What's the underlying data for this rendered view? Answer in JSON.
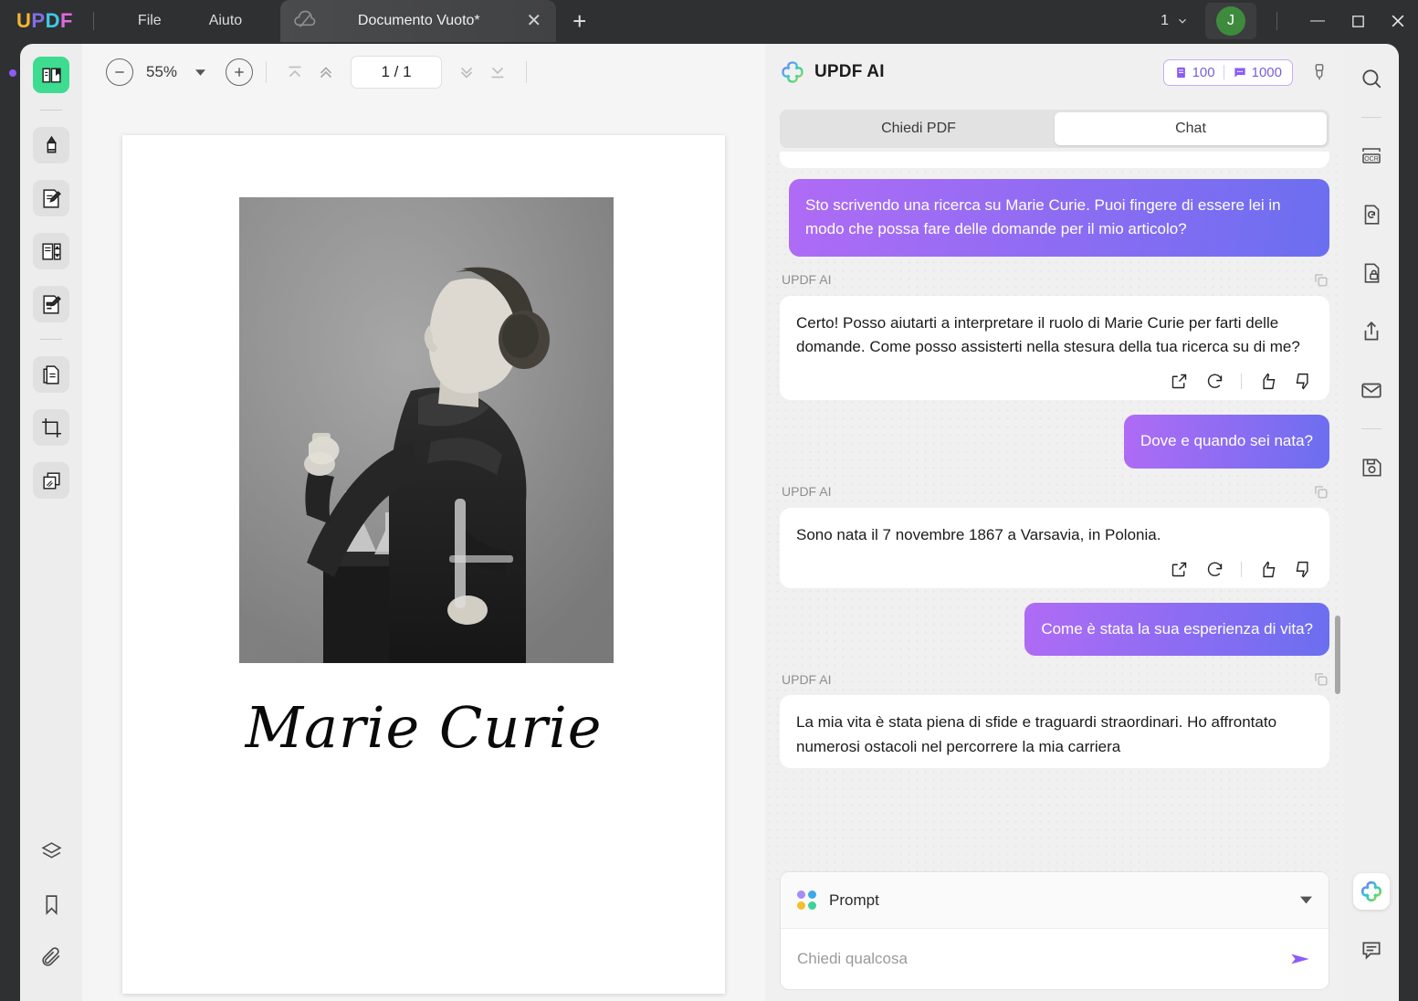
{
  "titlebar": {
    "brand": [
      "U",
      "P",
      "D",
      "F"
    ],
    "menus": [
      {
        "label": "File",
        "name": "menu-file"
      },
      {
        "label": "Aiuto",
        "name": "menu-aiuto"
      }
    ],
    "tab": {
      "title": "Documento Vuoto*",
      "close": "✕",
      "add": "+"
    },
    "page_indicator": "1",
    "avatar_initial": "J",
    "window": {
      "minimize": "—",
      "maximize": "□",
      "close": "✕"
    }
  },
  "toolbar": {
    "zoom_out": "−",
    "zoom_value": "55%",
    "zoom_in": "+",
    "page_field": "1 / 1"
  },
  "document": {
    "signature": "Marie Curie",
    "photo_alt": "marie-curie-portrait"
  },
  "left_rail": {
    "items": [
      {
        "name": "reader-icon",
        "label": "Lettore"
      },
      {
        "name": "annotate-highlighter-icon",
        "label": "Commento"
      },
      {
        "name": "edit-pdf-icon",
        "label": "Modifica PDF"
      },
      {
        "name": "organize-pages-icon",
        "label": "Organizza pagine"
      },
      {
        "name": "form-edit-icon",
        "label": "Modulo"
      },
      {
        "name": "page-convert-icon",
        "label": "Converti"
      },
      {
        "name": "crop-icon",
        "label": "Ritaglia"
      },
      {
        "name": "batch-icon",
        "label": "Batch"
      }
    ],
    "bottom_items": [
      {
        "name": "layers-icon",
        "label": "Livelli"
      },
      {
        "name": "bookmark-icon",
        "label": "Segnalibro"
      },
      {
        "name": "attachment-icon",
        "label": "Allegato"
      }
    ]
  },
  "right_rail": {
    "items": [
      {
        "name": "search-icon",
        "label": "Cerca"
      },
      {
        "name": "ocr-icon",
        "label": "OCR"
      },
      {
        "name": "convert-icon",
        "label": "Converti"
      },
      {
        "name": "protect-icon",
        "label": "Proteggi"
      },
      {
        "name": "share-icon",
        "label": "Condividi"
      },
      {
        "name": "email-icon",
        "label": "Email"
      },
      {
        "name": "save-icon",
        "label": "Salva"
      }
    ],
    "bottom_items": [
      {
        "name": "updf-ai-icon",
        "label": "UPDF AI"
      },
      {
        "name": "comment-icon",
        "label": "Commento"
      }
    ]
  },
  "ai_panel": {
    "title": "UPDF AI",
    "credits": {
      "documents": "100",
      "chats": "1000"
    },
    "brush_label": "Pulisci chat",
    "tabs": [
      {
        "label": "Chiedi PDF",
        "name": "tab-chiedi-pdf",
        "active": false
      },
      {
        "label": "Chat",
        "name": "tab-chat",
        "active": true
      }
    ],
    "ai_label": "UPDF AI",
    "messages": [
      {
        "role": "user",
        "text": "Sto scrivendo una ricerca su Marie Curie. Puoi fingere di essere lei in modo che possa fare delle domande per il mio articolo?"
      },
      {
        "role": "ai",
        "text": "Certo! Posso aiutarti a interpretare il ruolo di Marie Curie per farti delle domande. Come posso assisterti nella stesura della tua ricerca su di me?"
      },
      {
        "role": "user",
        "text": "Dove e quando sei nata?"
      },
      {
        "role": "ai",
        "text": "Sono nata il 7 novembre 1867 a Varsavia, in Polonia."
      },
      {
        "role": "user",
        "text": "Come è stata la sua esperienza di vita?"
      },
      {
        "role": "ai",
        "text": "La mia vita è stata piena di sfide e traguardi straordinari. Ho affrontato numerosi ostacoli nel percorrere la mia carriera"
      }
    ],
    "actions": {
      "export": "export-icon",
      "regenerate": "regenerate-icon",
      "like": "thumbs-up-icon",
      "dislike": "thumbs-down-icon",
      "copy": "copy-icon"
    },
    "input": {
      "prompt_label": "Prompt",
      "placeholder": "Chiedi qualcosa",
      "value": "",
      "send": "send-icon"
    }
  },
  "colors": {
    "accent_purple": "#8b5cf6",
    "bubble_start": "#b06bf5",
    "bubble_end": "#6b6ef0",
    "active_green": "#3ddc91",
    "titlebar": "#2f3032"
  }
}
